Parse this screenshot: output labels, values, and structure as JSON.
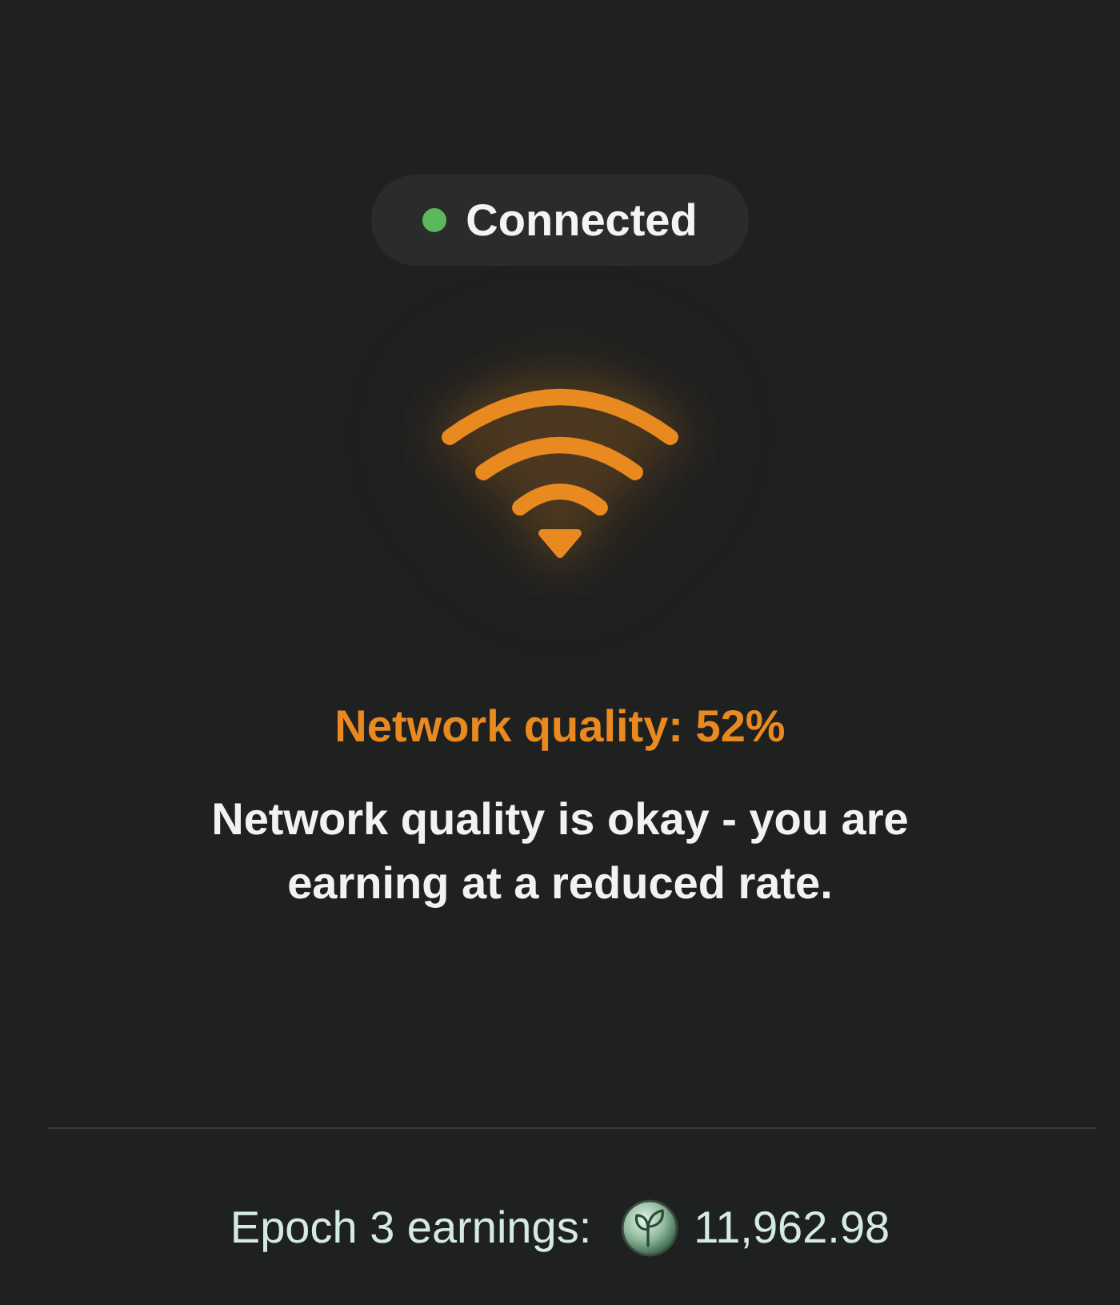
{
  "status": {
    "label": "Connected",
    "connected": true
  },
  "network": {
    "quality": "Network quality: 52%",
    "message": "Network quality is okay - you are earning at a reduced rate."
  },
  "earnings": {
    "label": "Epoch 3 earnings:",
    "amount": "11,962.98"
  }
}
